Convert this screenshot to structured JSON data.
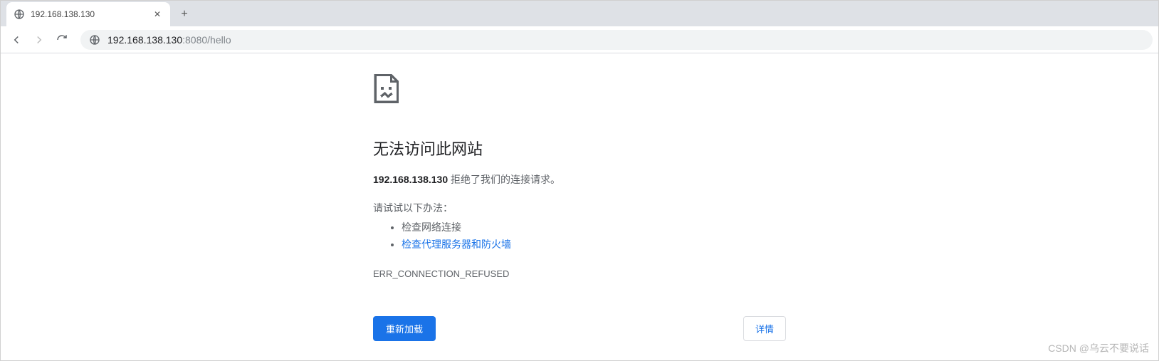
{
  "tab": {
    "title": "192.168.138.130",
    "close_glyph": "✕"
  },
  "toolbar": {
    "new_tab_glyph": "+",
    "url_host": "192.168.138.130",
    "url_port_path": ":8080/hello"
  },
  "error": {
    "heading": "无法访问此网站",
    "host_bold": "192.168.138.130",
    "refused_text": " 拒绝了我们的连接请求。",
    "try_label": "请试试以下办法：",
    "tips": {
      "check_network": "检查网络连接",
      "check_proxy": "检查代理服务器和防火墙"
    },
    "code": "ERR_CONNECTION_REFUSED",
    "reload_label": "重新加载",
    "details_label": "详情"
  },
  "watermark": "CSDN @乌云不要说话"
}
